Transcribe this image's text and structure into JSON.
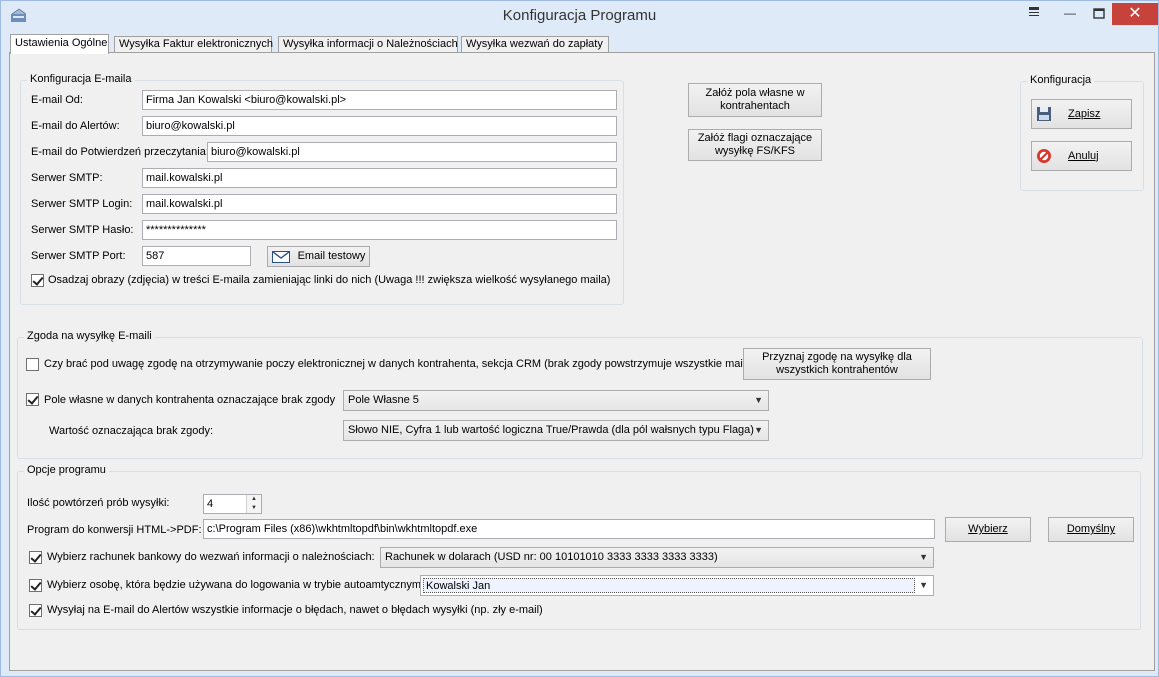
{
  "window": {
    "title": "Konfiguracja Programu"
  },
  "tabs": [
    {
      "label": "Ustawienia Ogólne"
    },
    {
      "label": "Wysyłka Faktur elektronicznych"
    },
    {
      "label": "Wysyłka informacji o Należnościach"
    },
    {
      "label": "Wysyłka wezwań do zapłaty"
    }
  ],
  "email_config": {
    "legend": "Konfiguracja E-maila",
    "from_label": "E-mail Od:",
    "from_value": "Firma Jan Kowalski <biuro@kowalski.pl>",
    "alerts_label": "E-mail do Alertów:",
    "alerts_value": "biuro@kowalski.pl",
    "read_label": "E-mail do Potwierdzeń przeczytania:",
    "read_value": "biuro@kowalski.pl",
    "smtp_label": "Serwer SMTP:",
    "smtp_value": "mail.kowalski.pl",
    "login_label": "Serwer SMTP Login:",
    "login_value": "mail.kowalski.pl",
    "password_label": "Serwer SMTP Hasło:",
    "password_value": "**************",
    "port_label": "Serwer SMTP Port:",
    "port_value": "587",
    "test_email_button": "Email testowy",
    "embed_images_label": "Osadzaj obrazy (zdjęcia) w treści E-maila zamieniając linki do nich (Uwaga !!! zwiększa wielkość wysyłanego maila)"
  },
  "actions": {
    "create_fields_button": "Załóż pola własne w kontrahentach",
    "create_flags_button": "Załóż flagi oznaczające wysyłkę FS/KFS"
  },
  "konfiguracja": {
    "legend": "Konfiguracja",
    "save_button": "Zapisz",
    "cancel_button": "Anuluj"
  },
  "consent": {
    "legend": "Zgoda na wysyłkę E-maili",
    "crm_label": "Czy brać pod uwagę zgodę na otrzymywanie poczy elektronicznej w danych kontrahenta, sekcja CRM (brak zgody powstrzymuje wszystkie maile)",
    "grant_all_button": "Przyznaj zgodę na wysyłkę dla wszystkich kontrahentów",
    "field_label": "Pole własne w danych kontrahenta oznaczające brak zgody",
    "field_value": "Pole Własne 5",
    "value_label": "Wartość oznaczająca brak zgody:",
    "value_value": "Słowo NIE, Cyfra 1 lub wartość logiczna True/Prawda (dla pól wałsnych typu Flaga)"
  },
  "options": {
    "legend": "Opcje programu",
    "retries_label": "Ilość powtórzeń prób wysyłki:",
    "retries_value": "4",
    "converter_label": "Program do konwersji HTML->PDF:",
    "converter_value": "c:\\Program Files (x86)\\wkhtmltopdf\\bin\\wkhtmltopdf.exe",
    "choose_button": "Wybierz",
    "default_button": "Domyślny",
    "bank_label": "Wybierz rachunek bankowy do wezwań informacji o należnościach:",
    "bank_value": "Rachunek w dolarach (USD nr: 00 10101010 3333 3333 3333 3333)",
    "person_label": "Wybierz osobę, która będzie używana do logowania w trybie autoamtycznym:",
    "person_value": "Kowalski Jan",
    "errors_label": "Wysyłaj na E-mail do Alertów wszystkie informacje o błędach, nawet o błędach wysyłki (np. zły e-mail)"
  }
}
